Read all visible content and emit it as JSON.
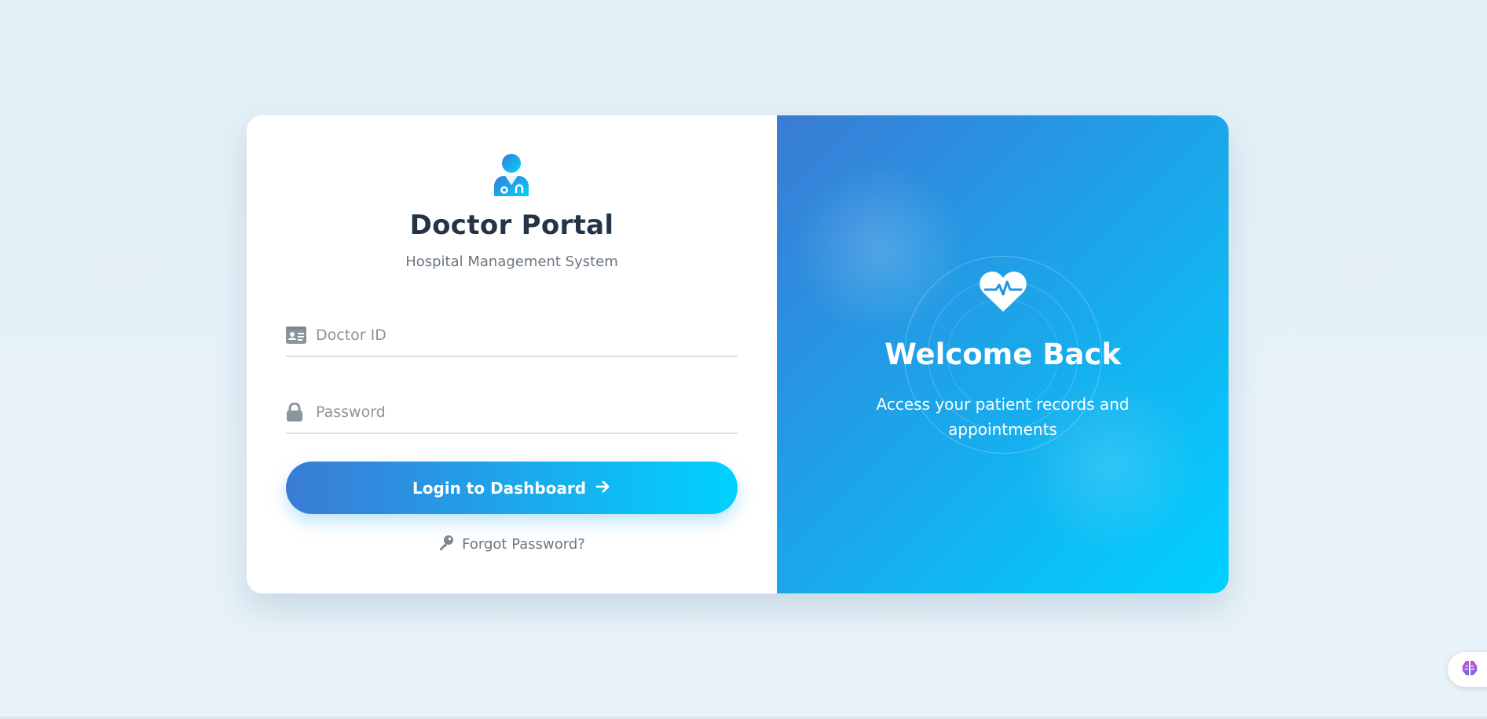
{
  "login": {
    "title": "Doctor Portal",
    "subtitle": "Hospital Management System",
    "doctor_id_placeholder": "Doctor ID",
    "password_placeholder": "Password",
    "login_button_label": "Login to Dashboard",
    "forgot_password_label": "Forgot Password?"
  },
  "welcome": {
    "title": "Welcome Back",
    "text": "Access your patient records and appointments"
  },
  "icons": {
    "logo": "doctor-icon",
    "doctor_id": "id-card-icon",
    "password": "lock-icon",
    "login_arrow": "arrow-right-icon",
    "forgot": "key-icon",
    "welcome": "heartbeat-icon",
    "widget": "brain-icon"
  },
  "colors": {
    "gradient_start": "#3a7bd5",
    "gradient_end": "#00d2ff",
    "title": "#243447",
    "muted_text": "#6b7680"
  }
}
